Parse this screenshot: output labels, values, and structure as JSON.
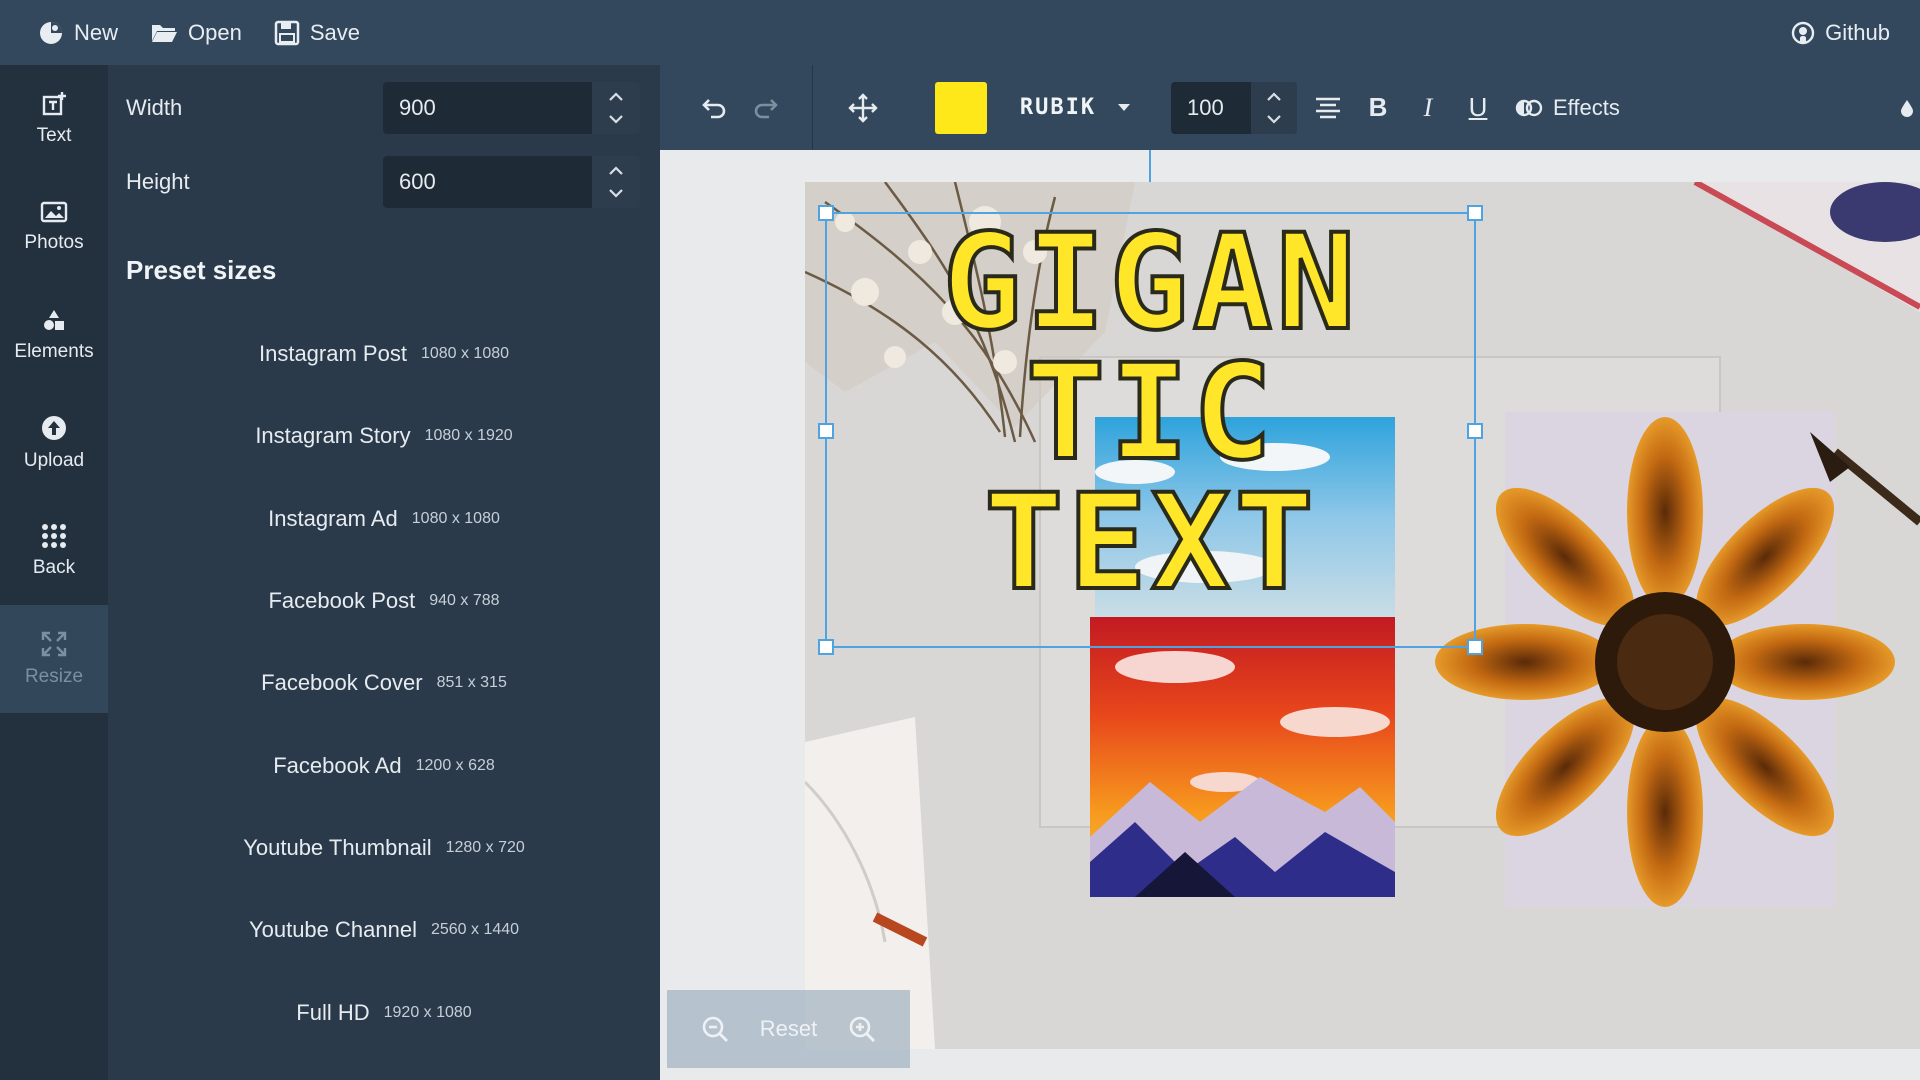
{
  "topbar": {
    "new_label": "New",
    "open_label": "Open",
    "save_label": "Save",
    "github_label": "Github"
  },
  "rail": {
    "items": [
      {
        "label": "Text",
        "icon": "text-add-icon"
      },
      {
        "label": "Photos",
        "icon": "photo-icon"
      },
      {
        "label": "Elements",
        "icon": "shapes-icon"
      },
      {
        "label": "Upload",
        "icon": "upload-icon"
      },
      {
        "label": "Back",
        "icon": "grid-icon"
      },
      {
        "label": "Resize",
        "icon": "resize-icon",
        "active": true
      }
    ]
  },
  "resize_panel": {
    "width_label": "Width",
    "width_value": "900",
    "height_label": "Height",
    "height_value": "600",
    "preset_title": "Preset sizes",
    "presets": [
      {
        "name": "Instagram Post",
        "size": "1080 x 1080"
      },
      {
        "name": "Instagram Story",
        "size": "1080 x 1920"
      },
      {
        "name": "Instagram Ad",
        "size": "1080 x 1080"
      },
      {
        "name": "Facebook Post",
        "size": "940 x 788"
      },
      {
        "name": "Facebook Cover",
        "size": "851 x 315"
      },
      {
        "name": "Facebook Ad",
        "size": "1200 x 628"
      },
      {
        "name": "Youtube Thumbnail",
        "size": "1280 x 720"
      },
      {
        "name": "Youtube Channel",
        "size": "2560 x 1440"
      },
      {
        "name": "Full HD",
        "size": "1920 x 1080"
      }
    ]
  },
  "toolbar": {
    "text_color": "#ffe81a",
    "font_family": "RUBIK",
    "font_size": "100",
    "bold_label": "B",
    "italic_label": "I",
    "underline_label": "U",
    "effects_label": "Effects"
  },
  "canvas": {
    "text_lines": [
      "GIGAN",
      "TIC",
      "TEXT"
    ]
  },
  "zoom": {
    "reset_label": "Reset"
  }
}
